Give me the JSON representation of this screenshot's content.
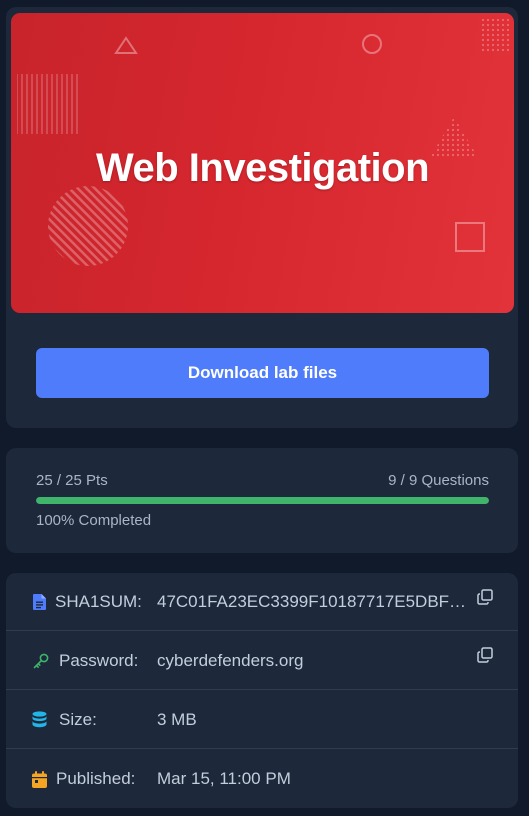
{
  "banner": {
    "title": "Web Investigation",
    "color": "#d6262e"
  },
  "actions": {
    "download_label": "Download lab files",
    "accent": "#4f7cfb"
  },
  "progress": {
    "points": "25 / 25 Pts",
    "questions": "9 / 9 Questions",
    "completed_label": "100% Completed",
    "fraction": 1.0,
    "bar_color": "#3fb46a"
  },
  "info": {
    "sha1": {
      "label": "SHA1SUM:",
      "value": "47C01FA23EC3399F10187717E5DBF…",
      "icon": "file-icon"
    },
    "password": {
      "label": "Password:",
      "value": "cyberdefenders.org",
      "icon": "key-icon"
    },
    "size": {
      "label": "Size:",
      "value": "3 MB",
      "icon": "database-icon"
    },
    "published": {
      "label": "Published:",
      "value": "Mar 15, 11:00 PM",
      "icon": "calendar-icon"
    }
  }
}
